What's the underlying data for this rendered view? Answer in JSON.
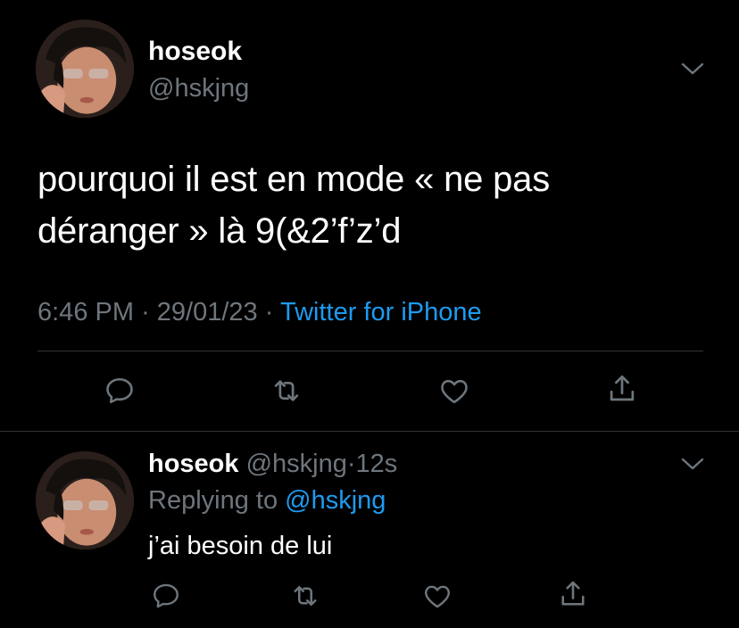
{
  "main_tweet": {
    "display_name": "hoseok",
    "handle": "@hskjng",
    "text_line1": "pourquoi il est en mode « ne pas",
    "text_line2": "déranger » là 9(&2’f’z’d",
    "time": "6:46 PM",
    "separator": "·",
    "date": "29/01/23",
    "source": "Twitter for iPhone"
  },
  "reply_tweet": {
    "display_name": "hoseok",
    "handle": "@hskjng",
    "separator": "·",
    "age": "12s",
    "replying_prefix": "Replying to",
    "replying_to": "@hskjng",
    "text": "j’ai besoin de lui"
  },
  "icons": {
    "options": "chevron-down-icon",
    "reply": "comment-icon",
    "retweet": "retweet-icon",
    "like": "heart-icon",
    "share": "share-icon"
  },
  "colors": {
    "background": "#000000",
    "primary_text": "#ffffff",
    "secondary_text": "#6e767d",
    "link": "#1d9bf0",
    "divider": "#2f3336"
  }
}
